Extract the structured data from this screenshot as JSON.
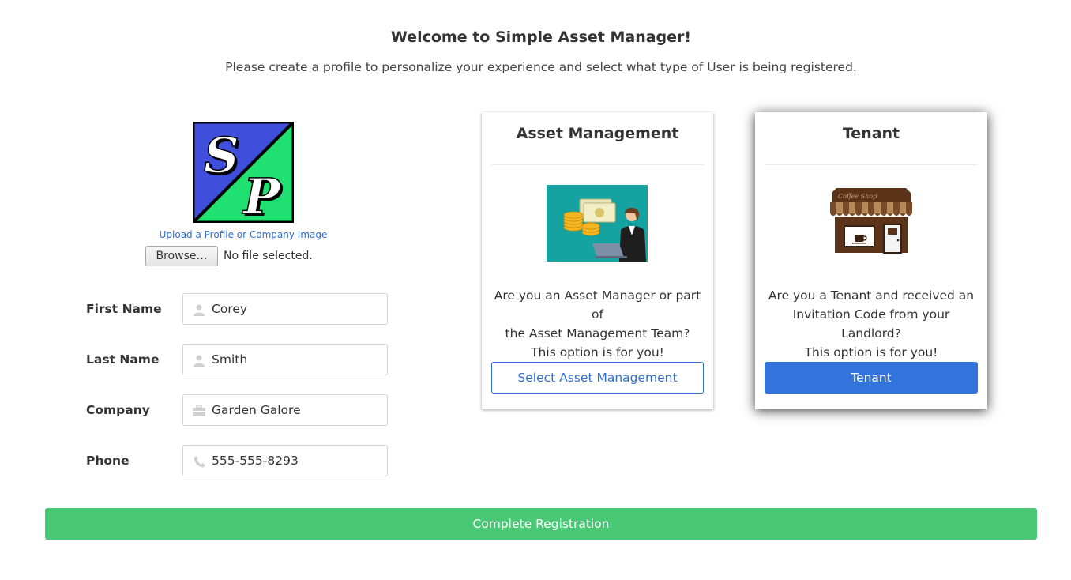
{
  "header": {
    "title": "Welcome to Simple Asset Manager!",
    "subtitle": "Please create a profile to personalize your experience and select what type of User is being registered."
  },
  "profile": {
    "logo_letters": "SP",
    "upload_link": "Upload a Profile or Company Image",
    "browse_label": "Browse…",
    "file_status": "No file selected."
  },
  "form": {
    "first_name_label": "First Name",
    "first_name_value": "Corey",
    "last_name_label": "Last Name",
    "last_name_value": "Smith",
    "company_label": "Company",
    "company_value": "Garden Galore",
    "phone_label": "Phone",
    "phone_value": "555-555-8293"
  },
  "cards": {
    "asset": {
      "title": "Asset Management",
      "line1": "Are you an Asset Manager or part of",
      "line2": "the Asset Management Team?",
      "line3": "This option is for you!",
      "button": "Select Asset Management"
    },
    "tenant": {
      "title": "Tenant",
      "sign": "Coffee Shop",
      "line1": "Are you a Tenant and received an",
      "line2": "Invitation Code from your Landlord?",
      "line3": "This option is for you!",
      "button": "Tenant"
    }
  },
  "actions": {
    "complete": "Complete Registration"
  },
  "colors": {
    "primary": "#3273dc",
    "success": "#48c774",
    "logo_blue": "#3f4fdb",
    "logo_green": "#1fe070"
  }
}
